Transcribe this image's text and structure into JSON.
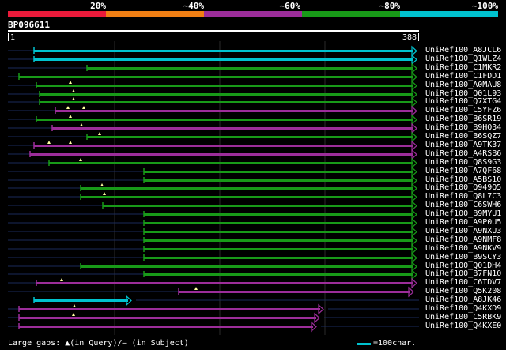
{
  "header_labels": [
    "20%",
    "~40%",
    "~60%",
    "~80%",
    "~100%"
  ],
  "color_bands": [
    {
      "color": "#ea1a3a"
    },
    {
      "color": "#f07f14"
    },
    {
      "color": "#9c2d9a"
    },
    {
      "color": "#189a18"
    },
    {
      "color": "#00c2cf"
    }
  ],
  "query_name": "BP096611",
  "scale": {
    "start": "1",
    "end": "388"
  },
  "rows": [
    {
      "name": "UniRef100_A8JCL6",
      "start": 43,
      "end": 527,
      "color": "#00c2cf",
      "tails": [
        43,
        0,
        0
      ],
      "gap_marks": []
    },
    {
      "name": "UniRef100_Q1WLZ4",
      "start": 43,
      "end": 527,
      "color": "#00c2cf",
      "tails": [
        43,
        0,
        0
      ],
      "gap_marks": []
    },
    {
      "name": "UniRef100_C1MKR2",
      "start": 110,
      "end": 527,
      "color": "#189a18",
      "tails": [
        110,
        0,
        0
      ],
      "gap_marks": []
    },
    {
      "name": "UniRef100_C1FDD1",
      "start": 24,
      "end": 527,
      "color": "#189a18",
      "tails": [
        24,
        0,
        0
      ],
      "gap_marks": []
    },
    {
      "name": "UniRef100_A0MAU8",
      "start": 46,
      "end": 527,
      "color": "#189a18",
      "tails": [
        46,
        0,
        0
      ],
      "gap_marks": [
        89
      ]
    },
    {
      "name": "UniRef100_Q01L93",
      "start": 50,
      "end": 527,
      "color": "#189a18",
      "tails": [
        50,
        0,
        0
      ],
      "gap_marks": [
        93
      ]
    },
    {
      "name": "UniRef100_Q7XTG4",
      "start": 50,
      "end": 527,
      "color": "#189a18",
      "tails": [
        50,
        0,
        0
      ],
      "gap_marks": [
        93
      ]
    },
    {
      "name": "UniRef100_C5YFZ6",
      "start": 70,
      "end": 527,
      "color": "#9c2d9a",
      "tails": [
        70,
        0,
        0
      ],
      "gap_marks": [
        86,
        106
      ]
    },
    {
      "name": "UniRef100_B6SR19",
      "start": 46,
      "end": 527,
      "color": "#189a18",
      "tails": [
        46,
        0,
        0
      ],
      "gap_marks": [
        89
      ]
    },
    {
      "name": "UniRef100_B9HQ34",
      "start": 66,
      "end": 527,
      "color": "#9c2d9a",
      "tails": [
        66,
        0,
        0
      ],
      "gap_marks": [
        103
      ]
    },
    {
      "name": "UniRef100_B6SQZ7",
      "start": 110,
      "end": 527,
      "color": "#189a18",
      "tails": [
        110,
        0,
        0
      ],
      "gap_marks": [
        126
      ]
    },
    {
      "name": "UniRef100_A9TK37",
      "start": 43,
      "end": 527,
      "color": "#9c2d9a",
      "tails": [
        43,
        0,
        0
      ],
      "gap_marks": [
        62,
        89
      ]
    },
    {
      "name": "UniRef100_A4RSB6",
      "start": 38,
      "end": 527,
      "color": "#9c2d9a",
      "tails": [
        38,
        0,
        0
      ],
      "gap_marks": []
    },
    {
      "name": "UniRef100_Q8S9G3",
      "start": 62,
      "end": 527,
      "color": "#189a18",
      "tails": [
        62,
        0,
        0
      ],
      "gap_marks": [
        102
      ]
    },
    {
      "name": "UniRef100_A7QF68",
      "start": 182,
      "end": 527,
      "color": "#189a18",
      "tails": [
        182,
        0,
        0
      ],
      "gap_marks": []
    },
    {
      "name": "UniRef100_A5BS10",
      "start": 182,
      "end": 527,
      "color": "#189a18",
      "tails": [
        182,
        0,
        0
      ],
      "gap_marks": []
    },
    {
      "name": "UniRef100_Q949Q5",
      "start": 102,
      "end": 527,
      "color": "#189a18",
      "tails": [
        102,
        0,
        0
      ],
      "gap_marks": [
        129
      ]
    },
    {
      "name": "UniRef100_Q8L7C3",
      "start": 102,
      "end": 527,
      "color": "#189a18",
      "tails": [
        102,
        0,
        0
      ],
      "gap_marks": [
        132
      ]
    },
    {
      "name": "UniRef100_C6SWH6",
      "start": 130,
      "end": 527,
      "color": "#189a18",
      "tails": [
        130,
        0,
        0
      ],
      "gap_marks": []
    },
    {
      "name": "UniRef100_B9MYU1",
      "start": 182,
      "end": 527,
      "color": "#189a18",
      "tails": [
        182,
        0,
        0
      ],
      "gap_marks": []
    },
    {
      "name": "UniRef100_A9P0U5",
      "start": 182,
      "end": 527,
      "color": "#189a18",
      "tails": [
        182,
        0,
        0
      ],
      "gap_marks": []
    },
    {
      "name": "UniRef100_A9NXU3",
      "start": 182,
      "end": 527,
      "color": "#189a18",
      "tails": [
        182,
        0,
        0
      ],
      "gap_marks": []
    },
    {
      "name": "UniRef100_A9NMF8",
      "start": 182,
      "end": 527,
      "color": "#189a18",
      "tails": [
        182,
        0,
        0
      ],
      "gap_marks": []
    },
    {
      "name": "UniRef100_A9NKV9",
      "start": 182,
      "end": 527,
      "color": "#189a18",
      "tails": [
        182,
        0,
        0
      ],
      "gap_marks": []
    },
    {
      "name": "UniRef100_B9SCY3",
      "start": 182,
      "end": 527,
      "color": "#189a18",
      "tails": [
        182,
        0,
        0
      ],
      "gap_marks": []
    },
    {
      "name": "UniRef100_Q01DH4",
      "start": 102,
      "end": 527,
      "color": "#189a18",
      "tails": [
        102,
        0,
        0
      ],
      "gap_marks": []
    },
    {
      "name": "UniRef100_B7FN10",
      "start": 182,
      "end": 527,
      "color": "#189a18",
      "tails": [
        182,
        0,
        0
      ],
      "gap_marks": []
    },
    {
      "name": "UniRef100_C6TDV7",
      "start": 46,
      "end": 527,
      "color": "#9c2d9a",
      "tails": [
        46,
        0,
        0
      ],
      "gap_marks": [
        78
      ]
    },
    {
      "name": "UniRef100_Q5K208",
      "start": 226,
      "end": 523,
      "color": "#9c2d9a",
      "tails": [
        226,
        0,
        0
      ],
      "gap_marks": [
        248
      ]
    },
    {
      "name": "UniRef100_A8JK46",
      "start": 43,
      "end": 166,
      "color": "#00c2cf",
      "tails": [
        0,
        0,
        0
      ],
      "gap_marks": []
    },
    {
      "name": "UniRef100_Q4KXD9",
      "start": 24,
      "end": 409,
      "color": "#9c2d9a",
      "tails": [
        24,
        0,
        0
      ],
      "gap_marks": [
        94
      ]
    },
    {
      "name": "UniRef100_C5RBK9",
      "start": 24,
      "end": 404,
      "color": "#9c2d9a",
      "tails": [
        24,
        0,
        0
      ],
      "gap_marks": [
        93
      ]
    },
    {
      "name": "UniRef100_Q4KXE0",
      "start": 24,
      "end": 400,
      "color": "#9c2d9a",
      "tails": [
        24,
        0,
        0
      ],
      "gap_marks": []
    }
  ],
  "footer": {
    "gaps_text": "Large gaps: ▲(in Query)/— (in Subject)",
    "legend_text": "=100char."
  }
}
